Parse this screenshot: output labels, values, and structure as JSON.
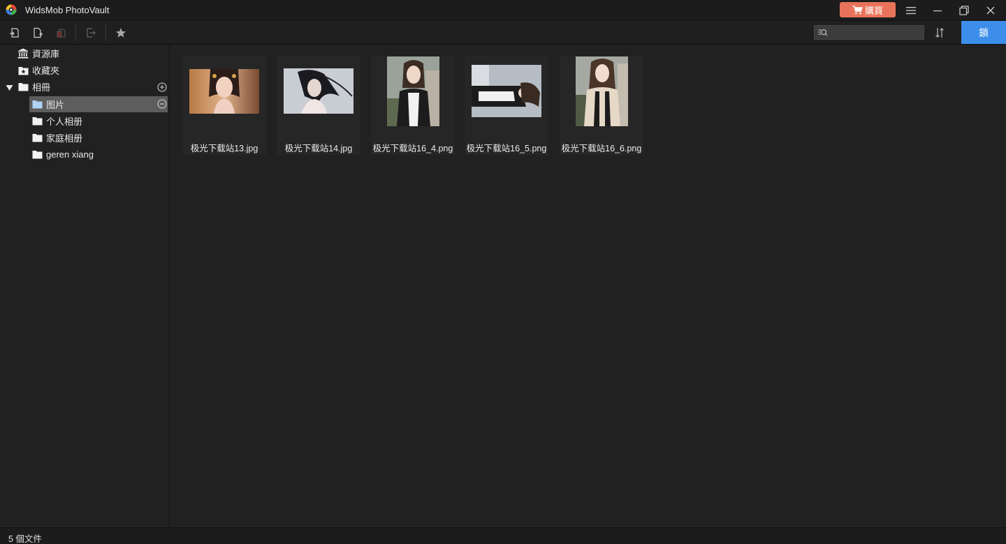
{
  "app": {
    "title": "WidsMob PhotoVault",
    "buy_label": "購買"
  },
  "toolbar": {
    "search_placeholder": "",
    "lock_label": "鎖"
  },
  "sidebar": {
    "library": "資源庫",
    "favorites": "收藏夾",
    "albums": "相冊",
    "album_items": [
      "图片",
      "个人相册",
      "家庭相册",
      "geren xiang"
    ]
  },
  "files": [
    {
      "name": "极光下载站13.jpg"
    },
    {
      "name": "极光下载站14.jpg"
    },
    {
      "name": "极光下载站16_4.png"
    },
    {
      "name": "极光下载站16_5.png"
    },
    {
      "name": "极光下载站16_6.png"
    }
  ],
  "status": {
    "count_text": "5 個文件"
  },
  "colors": {
    "accent": "#3d8eea",
    "buy": "#e8735a",
    "background": "#212121",
    "selected": "#5d5d5d"
  }
}
